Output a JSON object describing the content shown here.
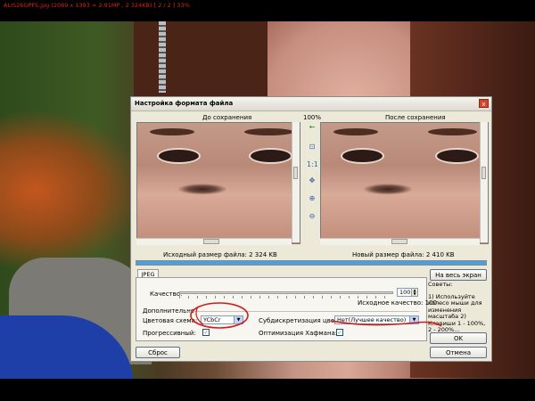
{
  "viewer": {
    "title": "ALIS26GPFS.jpg  (2089 x 1393 = 2.91MP  ,  2 324KB)  [ 2 / 2 ]   33%"
  },
  "dialog": {
    "title": "Настройка формата файла",
    "close": "x",
    "before_label": "До сохранения",
    "after_label": "После сохранения",
    "zoom": "100%",
    "original_size": "Исходный размер файла:  2 324 KB",
    "new_size": "Новый размер файла:  2 410 KB",
    "progress_fraction": 1.0,
    "tools": [
      {
        "name": "arrow-left-icon",
        "glyph": "←"
      },
      {
        "name": "fit-icon",
        "glyph": "⊡"
      },
      {
        "name": "actual-size-icon",
        "glyph": "1:1"
      },
      {
        "name": "move-icon",
        "glyph": "✥"
      },
      {
        "name": "zoom-in-icon",
        "glyph": "⊕"
      },
      {
        "name": "zoom-out-icon",
        "glyph": "⊖"
      }
    ],
    "fullscreen_button": "На весь экран",
    "tab_jpeg": "JPEG",
    "quality_label": "Качество:",
    "quality_value": "100",
    "orig_quality": "Исходное качество: 100",
    "extra_label": "Дополнительно",
    "color_scheme_label": "Цветовая схема:",
    "color_scheme_value": "YCbCr",
    "subsampling_label": "Субдискретизация цвета:",
    "subsampling_value": "Нет(Лучшее качество)",
    "progressive_label": "Прогрессивный:",
    "huffman_label": "Оптимизация Хафмана:",
    "check": "✓",
    "tips_title": "Советы:",
    "tips_text": "1) Используйте колесо мыши для изменения масштаба 2) Клавиши 1 - 100%, 2 - 200%...",
    "ok_button": "OK",
    "reset_button": "Сброс",
    "cancel_button": "Отмена"
  },
  "colors": {
    "annotation": "#d11a1a",
    "title_text": "#d42323"
  }
}
